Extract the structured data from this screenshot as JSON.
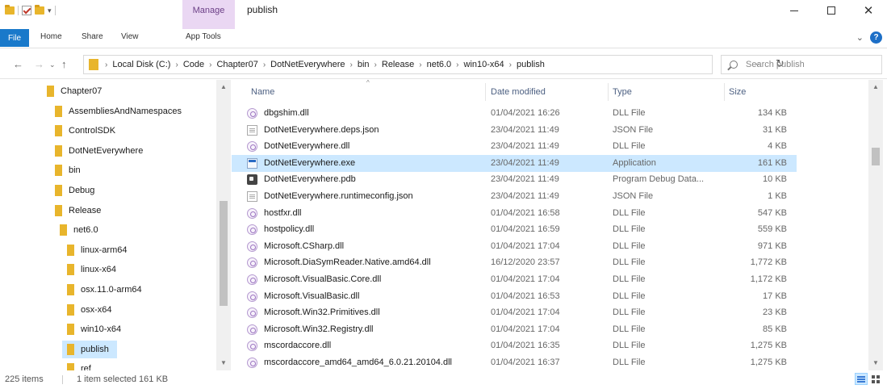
{
  "window": {
    "title": "publish",
    "context_tab": "Manage"
  },
  "ribbon": {
    "tabs": [
      "File",
      "Home",
      "Share",
      "View",
      "App Tools"
    ]
  },
  "address": {
    "crumbs": [
      "Local Disk (C:)",
      "Code",
      "Chapter07",
      "DotNetEverywhere",
      "bin",
      "Release",
      "net6.0",
      "win10-x64",
      "publish"
    ]
  },
  "search": {
    "placeholder": "Search publish"
  },
  "navpane": {
    "items": [
      {
        "label": "Chapter07",
        "level": 0
      },
      {
        "label": "AssembliesAndNamespaces",
        "level": 1
      },
      {
        "label": "ControlSDK",
        "level": 1
      },
      {
        "label": "DotNetEverywhere",
        "level": 1
      },
      {
        "label": "bin",
        "level": 2
      },
      {
        "label": "Debug",
        "level": 3
      },
      {
        "label": "Release",
        "level": 3
      },
      {
        "label": "net6.0",
        "level": 4
      },
      {
        "label": "linux-arm64",
        "level": 5
      },
      {
        "label": "linux-x64",
        "level": 5
      },
      {
        "label": "osx.11.0-arm64",
        "level": 5
      },
      {
        "label": "osx-x64",
        "level": 5
      },
      {
        "label": "win10-x64",
        "level": 5
      },
      {
        "label": "publish",
        "level": 6,
        "selected": true
      },
      {
        "label": "ref",
        "level": 5
      }
    ]
  },
  "filelist": {
    "columns": [
      "Name",
      "Date modified",
      "Type",
      "Size"
    ],
    "rows": [
      {
        "name": "dbgshim.dll",
        "date": "01/04/2021 16:26",
        "type": "DLL File",
        "size": "134 KB",
        "icon": "dll"
      },
      {
        "name": "DotNetEverywhere.deps.json",
        "date": "23/04/2021 11:49",
        "type": "JSON File",
        "size": "31 KB",
        "icon": "json"
      },
      {
        "name": "DotNetEverywhere.dll",
        "date": "23/04/2021 11:49",
        "type": "DLL File",
        "size": "4 KB",
        "icon": "dll"
      },
      {
        "name": "DotNetEverywhere.exe",
        "date": "23/04/2021 11:49",
        "type": "Application",
        "size": "161 KB",
        "icon": "exe",
        "selected": true
      },
      {
        "name": "DotNetEverywhere.pdb",
        "date": "23/04/2021 11:49",
        "type": "Program Debug Data...",
        "size": "10 KB",
        "icon": "pdb"
      },
      {
        "name": "DotNetEverywhere.runtimeconfig.json",
        "date": "23/04/2021 11:49",
        "type": "JSON File",
        "size": "1 KB",
        "icon": "json"
      },
      {
        "name": "hostfxr.dll",
        "date": "01/04/2021 16:58",
        "type": "DLL File",
        "size": "547 KB",
        "icon": "dll"
      },
      {
        "name": "hostpolicy.dll",
        "date": "01/04/2021 16:59",
        "type": "DLL File",
        "size": "559 KB",
        "icon": "dll"
      },
      {
        "name": "Microsoft.CSharp.dll",
        "date": "01/04/2021 17:04",
        "type": "DLL File",
        "size": "971 KB",
        "icon": "dll"
      },
      {
        "name": "Microsoft.DiaSymReader.Native.amd64.dll",
        "date": "16/12/2020 23:57",
        "type": "DLL File",
        "size": "1,772 KB",
        "icon": "dll"
      },
      {
        "name": "Microsoft.VisualBasic.Core.dll",
        "date": "01/04/2021 17:04",
        "type": "DLL File",
        "size": "1,172 KB",
        "icon": "dll"
      },
      {
        "name": "Microsoft.VisualBasic.dll",
        "date": "01/04/2021 16:53",
        "type": "DLL File",
        "size": "17 KB",
        "icon": "dll"
      },
      {
        "name": "Microsoft.Win32.Primitives.dll",
        "date": "01/04/2021 17:04",
        "type": "DLL File",
        "size": "23 KB",
        "icon": "dll"
      },
      {
        "name": "Microsoft.Win32.Registry.dll",
        "date": "01/04/2021 17:04",
        "type": "DLL File",
        "size": "85 KB",
        "icon": "dll"
      },
      {
        "name": "mscordaccore.dll",
        "date": "01/04/2021 16:35",
        "type": "DLL File",
        "size": "1,275 KB",
        "icon": "dll"
      },
      {
        "name": "mscordaccore_amd64_amd64_6.0.21.20104.dll",
        "date": "01/04/2021 16:37",
        "type": "DLL File",
        "size": "1,275 KB",
        "icon": "dll"
      }
    ]
  },
  "status": {
    "item_count": "225 items",
    "selection": "1 item selected  161 KB"
  },
  "colors": {
    "accent": "#1979ca",
    "selection": "#cce8ff",
    "manage_tab": "#ead7f3",
    "folder": "#e8b52c"
  }
}
